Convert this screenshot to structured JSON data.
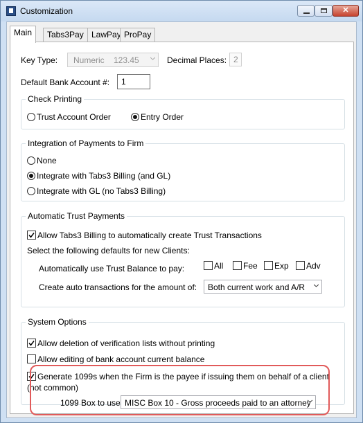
{
  "window": {
    "title": "Customization"
  },
  "tabs": [
    {
      "label": "Main",
      "active": true
    },
    {
      "label": "Tabs3Pay",
      "active": false
    },
    {
      "label": "LawPay",
      "active": false
    },
    {
      "label": "ProPay",
      "active": false
    }
  ],
  "main": {
    "key_type_label": "Key Type:",
    "key_type_value": "Numeric",
    "key_type_sample": "123.45",
    "decimal_places_label": "Decimal Places:",
    "decimal_places_value": "2",
    "bank_account_label": "Default Bank Account #:",
    "bank_account_value": "1"
  },
  "check_printing": {
    "title": "Check Printing",
    "options": [
      "Trust Account Order",
      "Entry Order"
    ],
    "selected": "Entry Order"
  },
  "integration": {
    "title": "Integration of Payments to Firm",
    "options": [
      "None",
      "Integrate with Tabs3 Billing (and GL)",
      "Integrate with GL (no Tabs3 Billing)"
    ],
    "selected": "Integrate with Tabs3 Billing (and GL)"
  },
  "auto_trust": {
    "title": "Automatic Trust Payments",
    "allow_label": "Allow Tabs3 Billing to automatically create Trust Transactions",
    "allow_checked": true,
    "defaults_label": "Select the following defaults for new Clients:",
    "use_balance_label": "Automatically use Trust Balance to pay:",
    "pay_options": [
      {
        "label": "All",
        "checked": false
      },
      {
        "label": "Fee",
        "checked": false
      },
      {
        "label": "Exp",
        "checked": false
      },
      {
        "label": "Adv",
        "checked": false
      }
    ],
    "amount_label": "Create auto transactions for the amount of:",
    "amount_value": "Both current work and A/R"
  },
  "system_options": {
    "title": "System Options",
    "allow_deletion_label": "Allow deletion of verification lists without printing",
    "allow_deletion_checked": true,
    "allow_editing_label": "Allow editing of bank account current balance",
    "allow_editing_checked": false,
    "generate_1099_line1": "Generate 1099s when the Firm is the payee if issuing them on behalf of a client",
    "generate_1099_line2": "(not common)",
    "generate_1099_checked": true,
    "box_label": "1099 Box to use:",
    "box_value": "MISC Box 10 - Gross proceeds paid to an attorney"
  },
  "colors": {
    "highlight": "#e15a5a",
    "title_bar": "#c5d9f0",
    "close_button": "#c6432f"
  },
  "icons": {
    "app": "app-icon",
    "minimize": "minimize-icon",
    "maximize": "maximize-icon",
    "close": "close-icon",
    "dropdown": "chevron-down-icon"
  }
}
